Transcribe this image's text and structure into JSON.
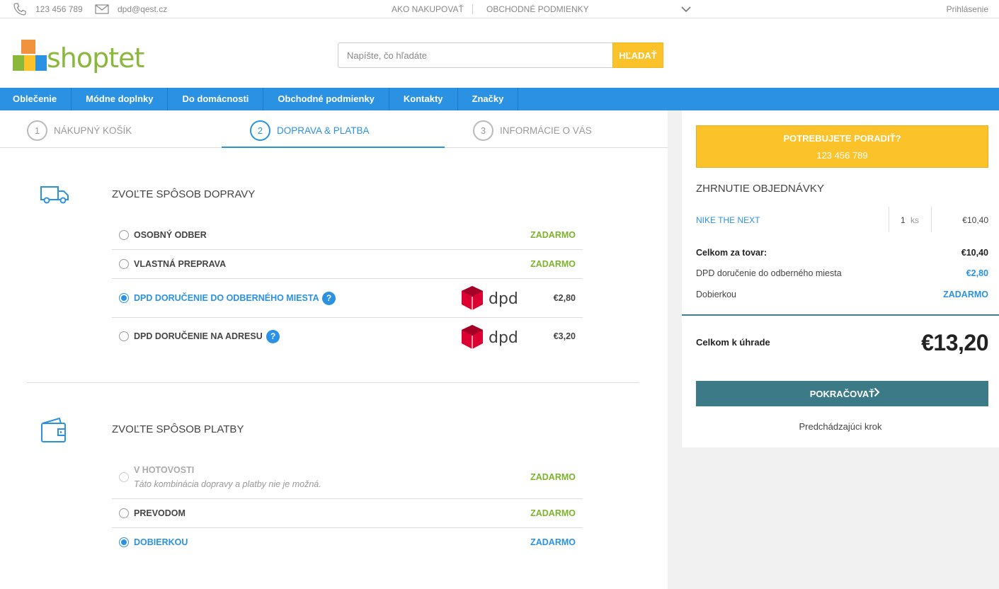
{
  "topbar": {
    "phone": "123 456 789",
    "email": "dpd@qest.cz",
    "links": [
      "AKO NAKUPOVAŤ",
      "OBCHODNÉ PODMIENKY"
    ],
    "login": "Prihlásenie"
  },
  "header": {
    "logo_text": "shoptet",
    "search_placeholder": "Napíšte, čo hľadáte",
    "search_button": "HĽADAŤ"
  },
  "nav": {
    "items": [
      "Oblečenie",
      "Módne doplnky",
      "Do domácnosti",
      "Obchodné podmienky",
      "Kontakty",
      "Značky"
    ]
  },
  "steps": [
    {
      "num": "1",
      "label": "NÁKUPNÝ KOŠÍK"
    },
    {
      "num": "2",
      "label": "DOPRAVA & PLATBA"
    },
    {
      "num": "3",
      "label": "INFORMÁCIE O VÁS"
    }
  ],
  "shipping": {
    "title": "ZVOĽTE SPÔSOB DOPRAVY",
    "options": [
      {
        "label": "OSOBNÝ ODBER",
        "price": "ZADARMO"
      },
      {
        "label": "VLASTNÁ PREPRAVA",
        "price": "ZADARMO"
      },
      {
        "label": "DPD DORUČENIE DO ODBERNÉHO MIESTA",
        "price": "€2,80",
        "help": "?"
      },
      {
        "label": "DPD DORUČENIE NA ADRESU",
        "price": "€3,20",
        "help": "?"
      }
    ],
    "selected": 2,
    "dpd_text": "dpd"
  },
  "payment": {
    "title": "ZVOĽTE SPÔSOB PLATBY",
    "options": [
      {
        "label": "V HOTOVOSTI",
        "note": "Táto kombinácia dopravy a platby nie je možná.",
        "price": "ZADARMO"
      },
      {
        "label": "PREVODOM",
        "price": "ZADARMO"
      },
      {
        "label": "DOBIERKOU",
        "price": "ZADARMO"
      }
    ],
    "selected": 2
  },
  "sidebar": {
    "advice_title": "POTREBUJETE PORADIŤ?",
    "advice_phone": "123 456 789",
    "summary_title": "ZHRNUTIE OBJEDNÁVKY",
    "product": {
      "name": "NIKE THE NEXT",
      "qty": "1",
      "unit": "ks",
      "price": "€10,40"
    },
    "rows": [
      {
        "label": "Celkom za tovar:",
        "value": "€10,40"
      },
      {
        "label": "DPD doručenie do odberného miesta",
        "value": "€2,80"
      },
      {
        "label": "Dobierkou",
        "value": "ZADARMO"
      }
    ],
    "total_label": "Celkom k úhrade",
    "total_value": "€13,20",
    "continue": "POKRAČOVAŤ",
    "previous": "Predchádzajúci krok"
  },
  "colors": {
    "accent": "#2b91e3",
    "cta": "#3c7a87",
    "yellow": "#fbc229",
    "green": "#7cb32a",
    "dpd_red": "#dc0032"
  }
}
